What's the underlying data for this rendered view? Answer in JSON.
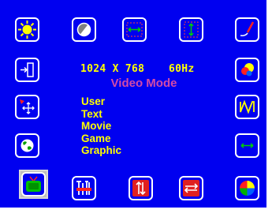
{
  "osd": {
    "resolution": "1024 X 768",
    "refresh_rate": "60Hz",
    "submenu_title": "Video Mode",
    "video_modes": [
      "User",
      "Text",
      "Movie",
      "Game",
      "Graphic"
    ],
    "selected_bottom_item": "tv-icon"
  },
  "colors": {
    "osd_background": "#0000f0",
    "icon_border": "#ffffff",
    "info_text": "#ffff00",
    "submenu_title": "#d34aa7",
    "menu_items": "#ffff00"
  }
}
